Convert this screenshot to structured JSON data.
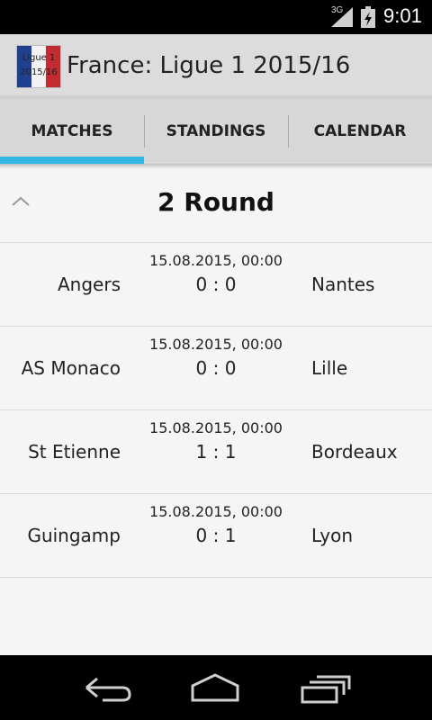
{
  "status_bar": {
    "network": "3G",
    "time": "9:01"
  },
  "app_bar": {
    "icon_text": "Ligue 1 2015/16",
    "title": "France: Ligue 1 2015/16"
  },
  "tabs": [
    {
      "label": "MATCHES",
      "selected": true
    },
    {
      "label": "STANDINGS",
      "selected": false
    },
    {
      "label": "CALENDAR",
      "selected": false
    }
  ],
  "round": {
    "title": "2 Round"
  },
  "matches": [
    {
      "date": "15.08.2015, 00:00",
      "home": "Angers",
      "score": "0 : 0",
      "away": "Nantes"
    },
    {
      "date": "15.08.2015, 00:00",
      "home": "AS Monaco",
      "score": "0 : 0",
      "away": "Lille"
    },
    {
      "date": "15.08.2015, 00:00",
      "home": "St Etienne",
      "score": "1 : 1",
      "away": "Bordeaux"
    },
    {
      "date": "15.08.2015, 00:00",
      "home": "Guingamp",
      "score": "0 : 1",
      "away": "Lyon"
    }
  ],
  "colors": {
    "accent": "#33b5e5",
    "app_bar": "#dcdcdc",
    "background": "#f5f5f5"
  }
}
